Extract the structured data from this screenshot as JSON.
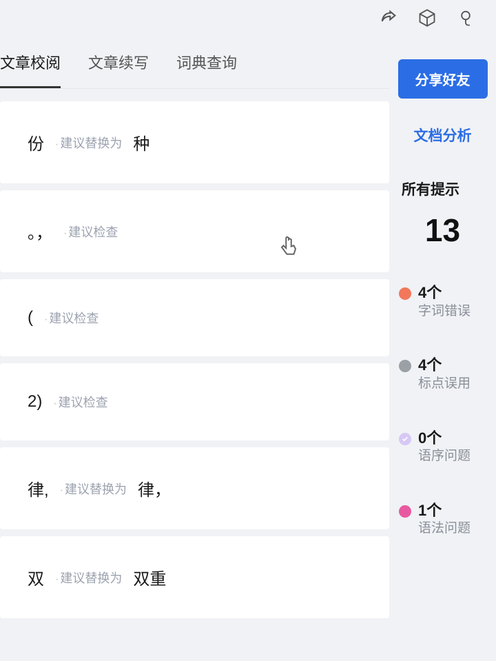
{
  "tabs": {
    "review": "文章校阅",
    "continue": "文章续写",
    "dictionary": "词典查询"
  },
  "suggestions": [
    {
      "original": "份",
      "hint": "建议替换为",
      "replacement": "种"
    },
    {
      "original": "。，",
      "hint": "建议检查",
      "replacement": ""
    },
    {
      "original": "(",
      "hint": "建议检查",
      "replacement": ""
    },
    {
      "original": "2)",
      "hint": "建议检查",
      "replacement": ""
    },
    {
      "original": "律,",
      "hint": "建议替换为",
      "replacement": "律，"
    },
    {
      "original": "双",
      "hint": "建议替换为",
      "replacement": "双重"
    }
  ],
  "right": {
    "share_label": "分享好友",
    "analysis_label": "文档分析",
    "all_hints_label": "所有提示",
    "total_count": "13",
    "categories": [
      {
        "count": "4个",
        "label": "字词错误",
        "color": "#f2785c"
      },
      {
        "count": "4个",
        "label": "标点误用",
        "color": "#9aa0a6"
      },
      {
        "count": "0个",
        "label": "语序问题",
        "color": "check"
      },
      {
        "count": "1个",
        "label": "语法问题",
        "color": "#e85aa0"
      }
    ]
  }
}
